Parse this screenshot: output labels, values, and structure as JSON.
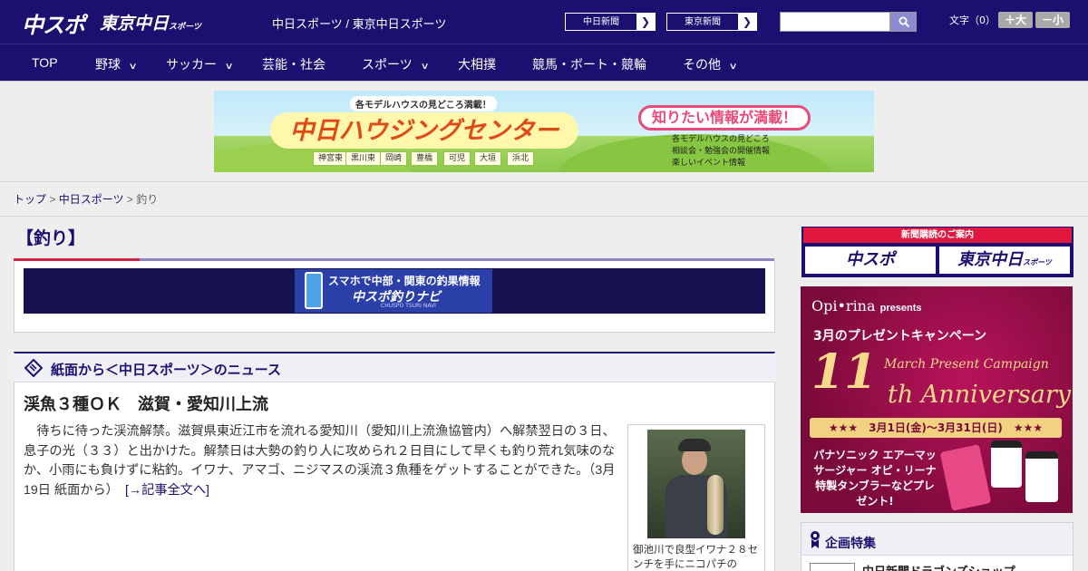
{
  "header": {
    "logo_chuspo": "中スポ",
    "logo_tokyo": "東京中日",
    "logo_tokyo_suffix": "スポーツ",
    "site_title": "中日スポーツ / 東京中日スポーツ",
    "links": [
      {
        "label": "中日新聞"
      },
      {
        "label": "東京新聞"
      }
    ],
    "search": {
      "placeholder": ""
    },
    "text_size": {
      "label": "文字（0）",
      "larger": "＋大",
      "smaller": "－小"
    }
  },
  "nav": [
    {
      "label": "TOP",
      "dropdown": false
    },
    {
      "label": "野球",
      "dropdown": true
    },
    {
      "label": "サッカー",
      "dropdown": true
    },
    {
      "label": "芸能・社会",
      "dropdown": false
    },
    {
      "label": "スポーツ",
      "dropdown": true
    },
    {
      "label": "大相撲",
      "dropdown": false
    },
    {
      "label": "競馬・ボート・競輪",
      "dropdown": false
    },
    {
      "label": "その他",
      "dropdown": true
    }
  ],
  "banner": {
    "sub": "各モデルハウスの見どころ満載！",
    "main": "中日ハウジングセンター",
    "catch": "知りたい情報が満載！",
    "features": [
      "各モデルハウスの見どころ",
      "相談会・勉強会の開催情報",
      "楽しいイベント情報"
    ],
    "areas": [
      "神宮東",
      "黒川東",
      "岡崎",
      "豊橋",
      "可児",
      "大垣",
      "浜北"
    ]
  },
  "breadcrumb": {
    "items": [
      "トップ",
      "中日スポーツ"
    ],
    "current": "釣り",
    "separator": ">"
  },
  "section": {
    "title": "【釣り】",
    "app_banner": {
      "line1": "スマホで中部・関東の釣果情報",
      "line2": "中スポ釣りナビ",
      "line3": "CHUSPO TSURI NAVI"
    }
  },
  "news": {
    "heading": "紙面から＜中日スポーツ＞のニュース",
    "article": {
      "title": "渓魚３種ＯＫ　滋賀・愛知川上流",
      "body": "待ちに待った渓流解禁。滋賀県東近江市を流れる愛知川（愛知川上流漁協管内）へ解禁翌日の３日、息子の光（３３）と出かけた。解禁日は大勢の釣り人に攻められ２日目にして早くも釣り荒れ気味のなか、小雨にも負けずに粘釣。イワナ、アマゴ、ニジマスの渓流３魚種をゲットすることができた。（3月19日 紙面から）",
      "more_link": "[→記事全文へ]",
      "caption": "御池川で良型イワナ２８センチを手にニコパチの"
    }
  },
  "sidebar": {
    "subscription": {
      "heading": "新聞購読のご案内",
      "buttons": [
        {
          "label": "中スポ",
          "suffix": ""
        },
        {
          "label": "東京中日",
          "suffix": "スポーツ"
        }
      ]
    },
    "campaign": {
      "brand": "Opi•rina",
      "brand_suffix": "presents",
      "line1": "3月のプレゼントキャンペーン",
      "number": "11",
      "subtitle": "March Present Campaign",
      "anniversary": "th Anniversary",
      "dates": "★★★　3月1日(金)〜3月31日(日)　★★★",
      "prizes": "パナソニック エアーマッサージャー オピ・リーナ特製タンブラーなどプレゼント!"
    },
    "features": {
      "heading": "企画特集",
      "items": [
        "中日新聞ドラゴンズショップ"
      ]
    }
  },
  "colors": {
    "brand_navy": "#1b1070",
    "accent_red": "#d6224a",
    "accent_purple": "#8b84c8"
  }
}
